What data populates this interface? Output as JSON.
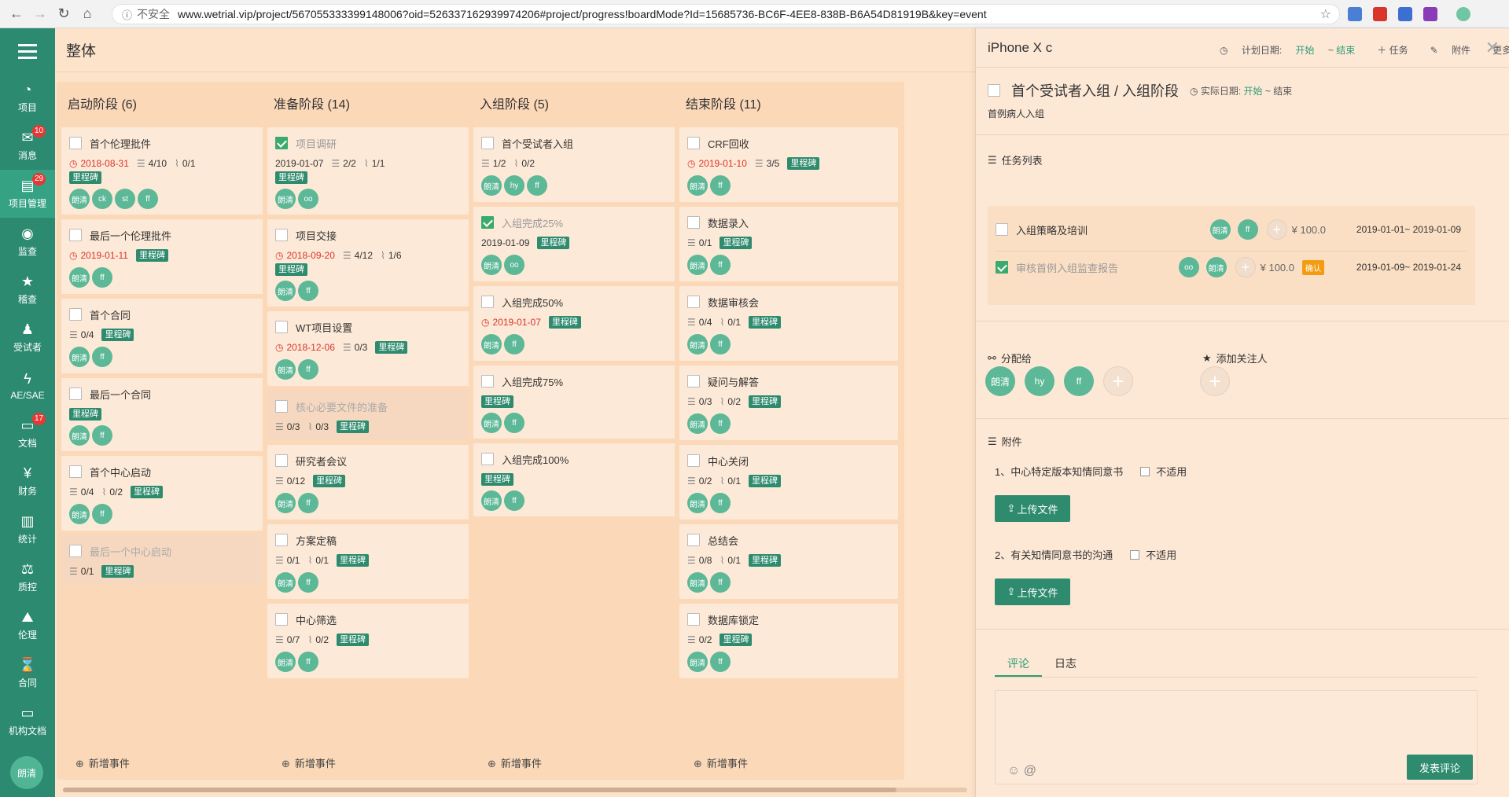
{
  "browser": {
    "insecure": "不安全",
    "url": "www.wetrial.vip/project/567055333399148006?oid=526337162939974206#project/progress!boardMode?Id=15685736-BC6F-4EE8-838B-B6A54D81919B&key=event"
  },
  "sidebar": {
    "items": [
      {
        "label": "项目",
        "icon": "pie-chart-icon"
      },
      {
        "label": "消息",
        "icon": "mail-icon",
        "badge": "10"
      },
      {
        "label": "项目管理",
        "icon": "inbox-icon",
        "badge": "29"
      },
      {
        "label": "监查",
        "icon": "eye-icon"
      },
      {
        "label": "稽查",
        "icon": "star-icon"
      },
      {
        "label": "受试者",
        "icon": "person-icon"
      },
      {
        "label": "AE/SAE",
        "icon": "bolt-icon"
      },
      {
        "label": "文档",
        "icon": "folder-icon",
        "badge": "17"
      },
      {
        "label": "财务",
        "icon": "yen-icon"
      },
      {
        "label": "统计",
        "icon": "bar-chart-icon"
      },
      {
        "label": "质控",
        "icon": "scale-icon"
      },
      {
        "label": "伦理",
        "icon": "road-icon"
      },
      {
        "label": "合同",
        "icon": "hourglass-icon"
      },
      {
        "label": "机构文档",
        "icon": "folder-icon"
      }
    ],
    "avatar": "朗清"
  },
  "header": {
    "title": "整体"
  },
  "board": {
    "add_event": "新增事件",
    "milestone": "里程碑",
    "columns": [
      {
        "title": "启动阶段 (6)",
        "cards": [
          {
            "title": "首个伦理批件",
            "date": "2018-08-31",
            "checklist": "4/10",
            "attach": "0/1",
            "avatars": [
              "朗清",
              "ck",
              "st",
              "ff"
            ]
          },
          {
            "title": "最后一个伦理批件",
            "date": "2019-01-11",
            "avatars": [
              "朗清",
              "ff"
            ]
          },
          {
            "title": "首个合同",
            "checklist": "0/4",
            "avatars": [
              "朗清",
              "ff"
            ]
          },
          {
            "title": "最后一个合同",
            "avatars": [
              "朗清",
              "ff"
            ]
          },
          {
            "title": "首个中心启动",
            "checklist": "0/4",
            "attach": "0/2",
            "avatars": [
              "朗清",
              "ff"
            ]
          },
          {
            "title": "最后一个中心启动",
            "checklist": "0/1"
          }
        ]
      },
      {
        "title": "准备阶段 (14)",
        "cards": [
          {
            "title": "项目调研",
            "date": "2019-01-07",
            "checklist": "2/2",
            "attach": "1/1",
            "avatars": [
              "朗清",
              "oo"
            ]
          },
          {
            "title": "项目交接",
            "date": "2018-09-20",
            "checklist": "4/12",
            "attach": "1/6",
            "avatars": [
              "朗清",
              "ff"
            ]
          },
          {
            "title": "WT项目设置",
            "date": "2018-12-06",
            "checklist": "0/3",
            "avatars": [
              "朗清",
              "ff"
            ]
          },
          {
            "title": "核心必要文件的准备",
            "checklist": "0/3",
            "attach": "0/3"
          },
          {
            "title": "研究者会议",
            "checklist": "0/12",
            "avatars": [
              "朗清",
              "ff"
            ]
          },
          {
            "title": "方案定稿",
            "checklist": "0/1",
            "attach": "0/1",
            "avatars": [
              "朗清",
              "ff"
            ]
          },
          {
            "title": "中心筛选",
            "checklist": "0/7",
            "attach": "0/2",
            "avatars": [
              "朗清",
              "ff"
            ]
          }
        ]
      },
      {
        "title": "入组阶段 (5)",
        "cards": [
          {
            "title": "首个受试者入组",
            "checklist": "1/2",
            "attach": "0/2",
            "avatars": [
              "朗清",
              "hy",
              "ff"
            ]
          },
          {
            "title": "入组完成25%",
            "date": "2019-01-09",
            "avatars": [
              "朗清",
              "oo"
            ]
          },
          {
            "title": "入组完成50%",
            "date": "2019-01-07",
            "avatars": [
              "朗清",
              "ff"
            ]
          },
          {
            "title": "入组完成75%",
            "avatars": [
              "朗清",
              "ff"
            ]
          },
          {
            "title": "入组完成100%",
            "avatars": [
              "朗清",
              "ff"
            ]
          }
        ]
      },
      {
        "title": "结束阶段 (11)",
        "cards": [
          {
            "title": "CRF回收",
            "date": "2019-01-10",
            "checklist": "3/5",
            "avatars": [
              "朗清",
              "ff"
            ]
          },
          {
            "title": "数据录入",
            "checklist": "0/1",
            "avatars": [
              "朗清",
              "ff"
            ]
          },
          {
            "title": "数据审核会",
            "checklist": "0/4",
            "attach": "0/1",
            "avatars": [
              "朗清",
              "ff"
            ]
          },
          {
            "title": "疑问与解答",
            "checklist": "0/3",
            "attach": "0/2",
            "avatars": [
              "朗清",
              "ff"
            ]
          },
          {
            "title": "中心关闭",
            "checklist": "0/2",
            "attach": "0/1",
            "avatars": [
              "朗清",
              "ff"
            ]
          },
          {
            "title": "总结会",
            "checklist": "0/8",
            "attach": "0/1",
            "avatars": [
              "朗清",
              "ff"
            ]
          },
          {
            "title": "数据库锁定",
            "checklist": "0/2",
            "avatars": [
              "朗清",
              "ff"
            ]
          }
        ]
      }
    ]
  },
  "panel": {
    "project": "iPhone X c",
    "plan_label": "计划日期:",
    "start": "开始",
    "tilde": "~",
    "end": "结束",
    "task_btn": "任务",
    "attach_btn": "附件",
    "more_btn": "更多",
    "title": "首个受试者入组 / 入组阶段",
    "actual_label": "实际日期:",
    "subtitle": "首例病人入组",
    "tasks_heading": "任务列表",
    "tasks": [
      {
        "title": "入组策略及培训",
        "avatars": [
          "朗清",
          "ff"
        ],
        "amount": "¥ 100.0",
        "range": "2019-01-01~ 2019-01-09"
      },
      {
        "title": "审核首例入组监查报告",
        "avatars": [
          "oo",
          "朗清"
        ],
        "amount": "¥ 100.0",
        "confirm": "确认",
        "range": "2019-01-09~ 2019-01-24"
      }
    ],
    "assign_heading": "分配给",
    "assign_avatars": [
      "朗清",
      "hy",
      "ff"
    ],
    "follow_heading": "添加关注人",
    "attach_heading": "附件",
    "attachments": [
      {
        "title": "1、中心特定版本知情同意书",
        "na": "不适用",
        "upload": "上传文件"
      },
      {
        "title": "2、有关知情同意书的沟通",
        "na": "不适用",
        "upload": "上传文件"
      }
    ],
    "tabs": [
      "评论",
      "日志"
    ],
    "send": "发表评论"
  }
}
